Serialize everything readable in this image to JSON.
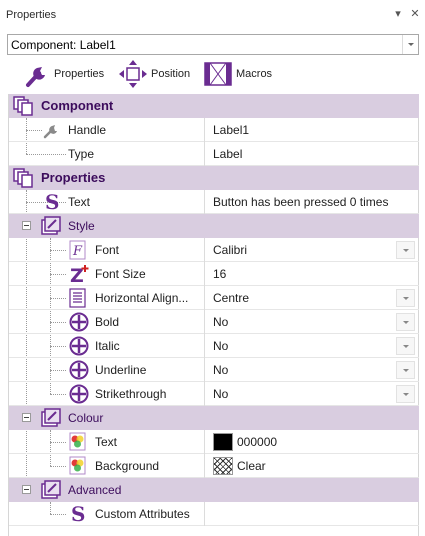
{
  "panel": {
    "title": "Properties",
    "pin_glyph": "▾",
    "close_glyph": "✕"
  },
  "component_selector": {
    "value": "Component: Label1"
  },
  "toolbar": [
    {
      "label": "Properties",
      "icon": "wrench-icon"
    },
    {
      "label": "Position",
      "icon": "move-arrows-icon"
    },
    {
      "label": "Macros",
      "icon": "film-strip-icon"
    }
  ],
  "grid": {
    "component": {
      "label": "Component",
      "handle_name": "Handle",
      "handle_value": "Label1",
      "type_name": "Type",
      "type_value": "Label"
    },
    "properties": {
      "label": "Properties",
      "text_name": "Text",
      "text_value": "Button has been pressed 0 times",
      "style": {
        "label": "Style",
        "font_name": "Font",
        "font_value": "Calibri",
        "fontsize_name": "Font Size",
        "fontsize_value": "16",
        "halign_name": "Horizontal Align...",
        "halign_value": "Centre",
        "bold_name": "Bold",
        "bold_value": "No",
        "italic_name": "Italic",
        "italic_value": "No",
        "underline_name": "Underline",
        "underline_value": "No",
        "strike_name": "Strikethrough",
        "strike_value": "No"
      },
      "colour": {
        "label": "Colour",
        "text_name": "Text",
        "text_value": "000000",
        "bg_name": "Background",
        "bg_value": "Clear"
      },
      "advanced": {
        "label": "Advanced",
        "custom_name": "Custom Attributes",
        "custom_value": ""
      }
    }
  },
  "colors": {
    "category_bg": "#d9cde0",
    "category_text": "#3c0c5c",
    "icon_purple": "#6a2c91"
  }
}
